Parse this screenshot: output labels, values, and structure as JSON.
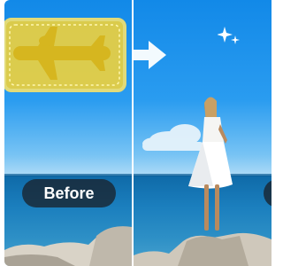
{
  "before_label": "Before",
  "colors": {
    "selection_fill": "#f0d23c",
    "sky": "#1289e8",
    "sea": "#1b7fbe"
  },
  "icons": [
    "right-arrow-icon",
    "sparkle-icon"
  ]
}
